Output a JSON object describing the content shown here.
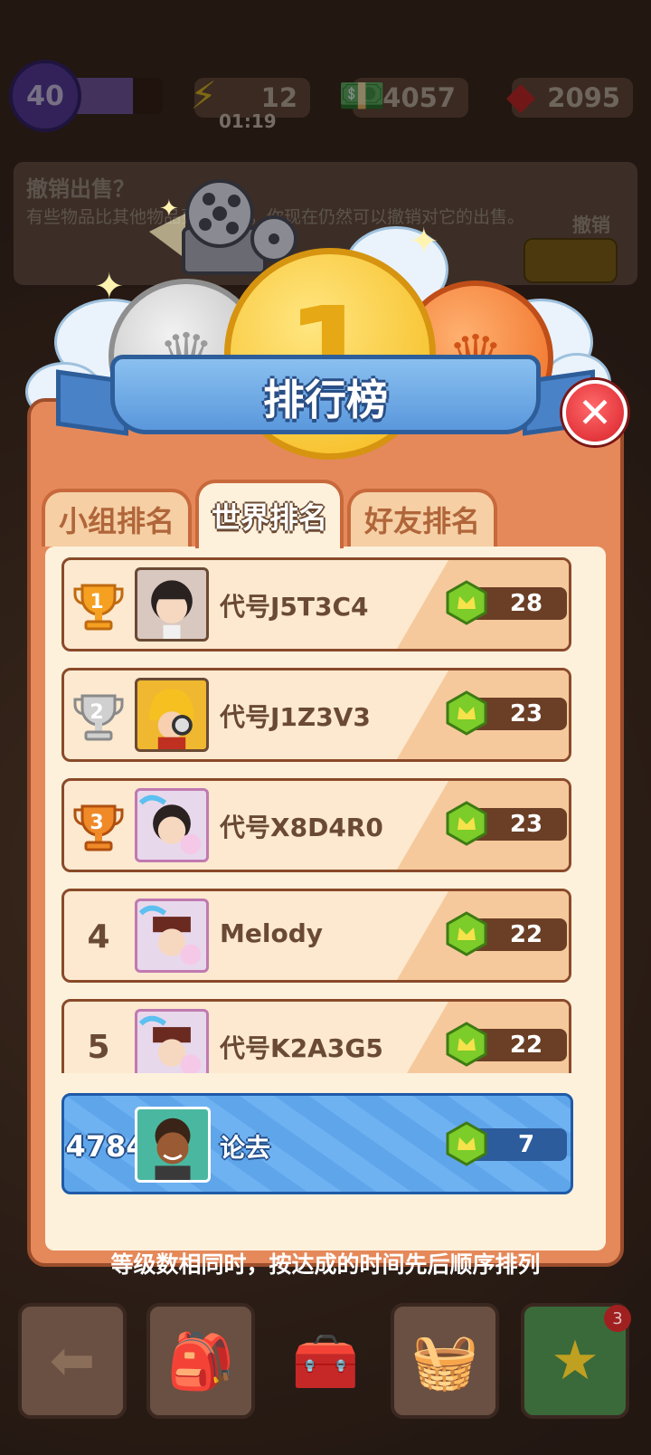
{
  "hud": {
    "level": "40",
    "level_progress": 0.7,
    "energy": "12",
    "energy_timer": "01:19",
    "cash": "54057",
    "gems": "2095"
  },
  "background_notice": {
    "title": "撤销出售？",
    "body": "有些物品比其他物品更有价值，你现在仍然可以撤销对它的出售。",
    "undo_label": "撤销"
  },
  "leaderboard": {
    "title": "排行榜",
    "tabs": [
      {
        "label": "小组排名",
        "active": false
      },
      {
        "label": "世界排名",
        "active": true
      },
      {
        "label": "好友排名",
        "active": false
      }
    ],
    "rows": [
      {
        "rank": "1",
        "name": "代号J5T3C4",
        "score": "28",
        "trophy": "gold"
      },
      {
        "rank": "2",
        "name": "代号J1Z3V3",
        "score": "23",
        "trophy": "silver"
      },
      {
        "rank": "3",
        "name": "代号X8D4R0",
        "score": "23",
        "trophy": "bronze"
      },
      {
        "rank": "4",
        "name": "Melody",
        "score": "22",
        "trophy": ""
      },
      {
        "rank": "5",
        "name": "代号K2A3G5",
        "score": "22",
        "trophy": ""
      }
    ],
    "me": {
      "rank": "4784",
      "name": "论去",
      "score": "7"
    },
    "footnote": "等级数相同时，按达成的时间先后顺序排列"
  },
  "bottom_bar": {
    "badge_count": "3"
  },
  "colors": {
    "panel": "#e5895a",
    "ribbon": "#5a98dc",
    "close": "#d8202a",
    "me_row": "#5fa5ea"
  }
}
